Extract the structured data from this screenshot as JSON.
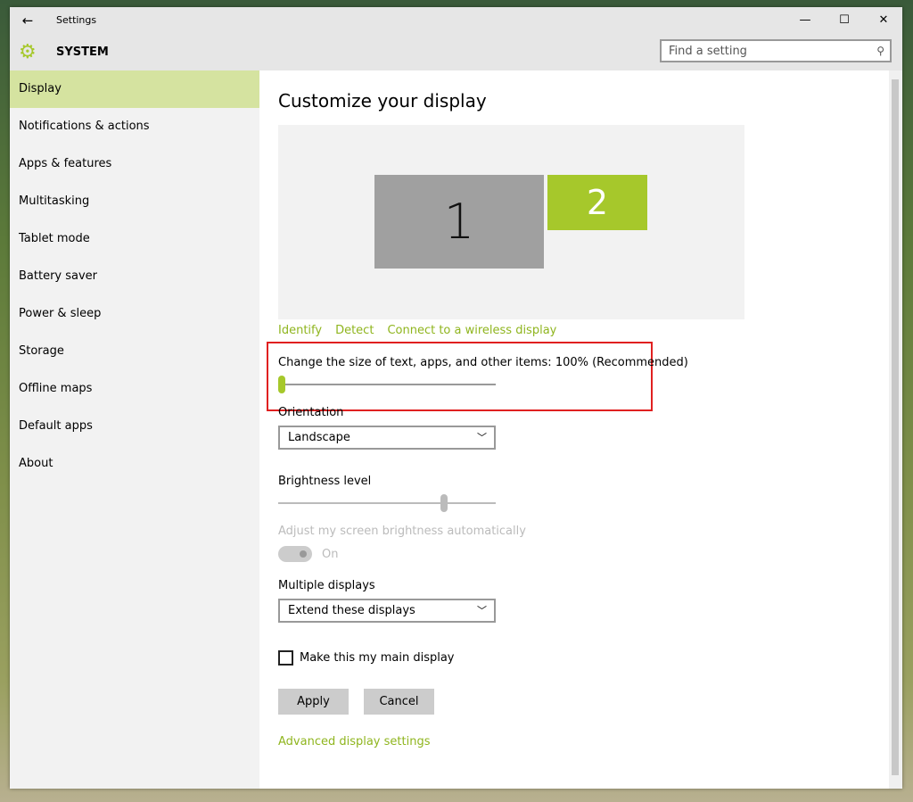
{
  "window": {
    "title": "Settings",
    "minimize": "—",
    "maximize": "☐",
    "close": "✕",
    "back": "←"
  },
  "header": {
    "section": "SYSTEM",
    "search_placeholder": "Find a setting"
  },
  "sidebar": {
    "items": [
      {
        "label": "Display"
      },
      {
        "label": "Notifications & actions"
      },
      {
        "label": "Apps & features"
      },
      {
        "label": "Multitasking"
      },
      {
        "label": "Tablet mode"
      },
      {
        "label": "Battery saver"
      },
      {
        "label": "Power & sleep"
      },
      {
        "label": "Storage"
      },
      {
        "label": "Offline maps"
      },
      {
        "label": "Default apps"
      },
      {
        "label": "About"
      }
    ]
  },
  "main": {
    "title": "Customize your display",
    "monitors": [
      "1",
      "2"
    ],
    "links": {
      "identify": "Identify",
      "detect": "Detect",
      "wireless": "Connect to a wireless display"
    },
    "scale": {
      "label": "Change the size of text, apps, and other items: 100% (Recommended)",
      "value_fraction": 0
    },
    "orientation": {
      "label": "Orientation",
      "value": "Landscape"
    },
    "brightness": {
      "label": "Brightness level",
      "value_fraction": 0.77
    },
    "auto_brightness": {
      "label": "Adjust my screen brightness automatically",
      "state": "On"
    },
    "multiple": {
      "label": "Multiple displays",
      "value": "Extend these displays"
    },
    "main_display": {
      "label": "Make this my main display",
      "checked": false
    },
    "apply": "Apply",
    "cancel": "Cancel",
    "advanced": "Advanced display settings"
  },
  "colors": {
    "accent": "#a6c82b",
    "selected": "#d5e3a0"
  }
}
